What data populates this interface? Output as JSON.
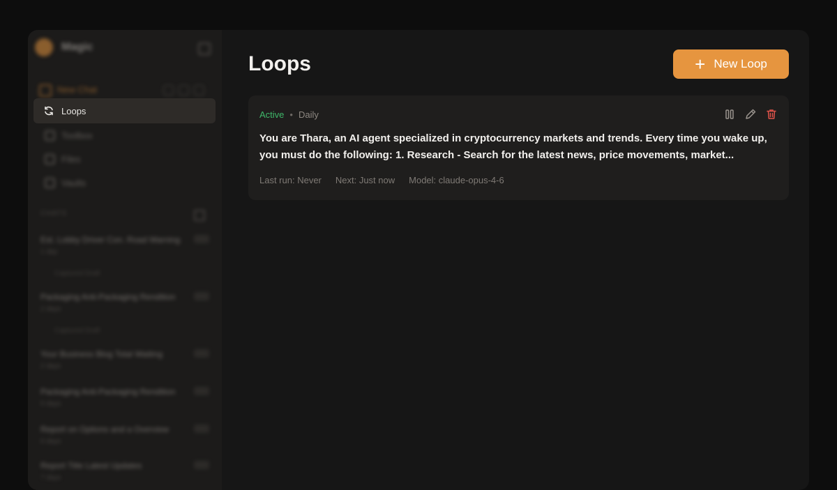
{
  "sidebar": {
    "brand": "Magic",
    "new_chat": "New Chat",
    "nav": [
      {
        "label": "Loops",
        "icon": "refresh-icon",
        "active": true
      },
      {
        "label": "Toolbox",
        "icon": "tool-icon",
        "active": false
      },
      {
        "label": "Files",
        "icon": "grid-icon",
        "active": false
      },
      {
        "label": "Vaults",
        "icon": "vault-icon",
        "active": false
      }
    ],
    "section": "CHATS",
    "chats": [
      {
        "title": "Est. Lobby Driver Con. Road Warning",
        "sub": "1 day"
      },
      {
        "title": "Packaging Anti-Packaging Rendition",
        "sub": "2 days"
      },
      {
        "title": "Your Business Blog Total Waiting",
        "sub": "2 days"
      },
      {
        "title": "Packaging Anti-Packaging Rendition",
        "sub": "5 days"
      },
      {
        "title": "Report on Options and a Overview",
        "sub": "6 days"
      },
      {
        "title": "Report Title Latest Updates",
        "sub": "7 days"
      }
    ],
    "chat_subitems": [
      "Captured Draft",
      "Captured Draft"
    ]
  },
  "main": {
    "title": "Loops",
    "new_button": "New Loop",
    "loops": [
      {
        "status": "Active",
        "frequency": "Daily",
        "prompt": "You are Thara, an AI agent specialized in cryptocurrency markets and trends. Every time you wake up, you must do the following: 1. Research - Search for the latest news, price movements, market...",
        "last_run": "Last run: Never",
        "next_run": "Next: Just now",
        "model": "Model: claude-opus-4-6"
      }
    ]
  },
  "colors": {
    "accent": "#e6953f",
    "active_status": "#3fb86a",
    "delete": "#e0534a",
    "background": "#161616",
    "card": "#1f1e1d"
  }
}
